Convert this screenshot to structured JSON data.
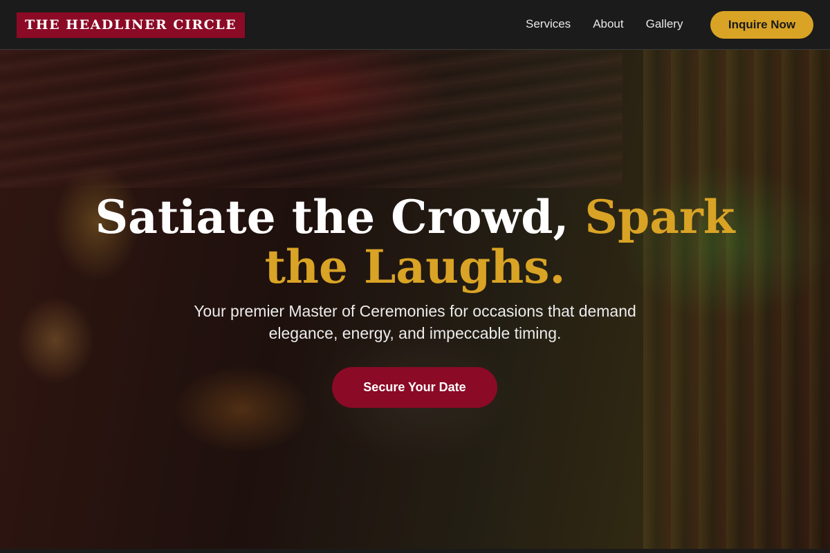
{
  "brand": {
    "logo_text": "THE HEADLINER CIRCLE"
  },
  "nav": {
    "links": [
      "Services",
      "About",
      "Gallery"
    ],
    "cta_label": "Inquire Now"
  },
  "hero": {
    "headline_white": "Satiate the Crowd, ",
    "headline_accent": "Spark the Laughs.",
    "subtitle": "Your premier Master of Ceremonies for occasions that demand elegance, energy, and impeccable timing.",
    "cta_label": "Secure Your Date"
  },
  "colors": {
    "brand_red": "#8b0a26",
    "accent_gold": "#d9a325",
    "nav_background": "#1b1b1b"
  }
}
